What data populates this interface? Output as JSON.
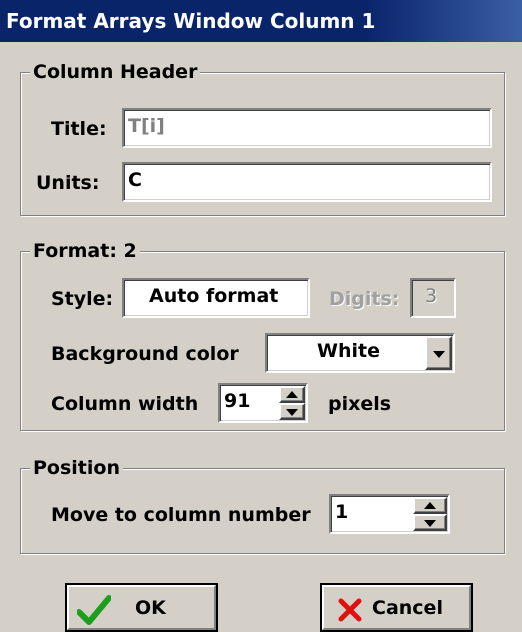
{
  "window": {
    "title": "Format Arrays Window Column 1"
  },
  "column_header": {
    "legend": "Column Header",
    "title_label": "Title:",
    "title_value": "T[i]",
    "units_label": "Units:",
    "units_value": "C"
  },
  "format": {
    "legend": "Format: 2",
    "style_label": "Style:",
    "style_value": "Auto format",
    "digits_label": "Digits:",
    "digits_value": "3",
    "bg_label": "Background color",
    "bg_value": "White",
    "width_label": "Column width",
    "width_value": "91",
    "width_unit": "pixels"
  },
  "position": {
    "legend": "Position",
    "move_label": "Move to column number",
    "move_value": "1"
  },
  "buttons": {
    "ok": "OK",
    "cancel": "Cancel"
  },
  "colors": {
    "titlebar": "#0a246a",
    "disabled_text": "#808080",
    "ok_check": "#1e9e1e",
    "cancel_x": "#e01010"
  },
  "icons": {
    "ok": "checkmark-icon",
    "cancel": "x-icon"
  }
}
